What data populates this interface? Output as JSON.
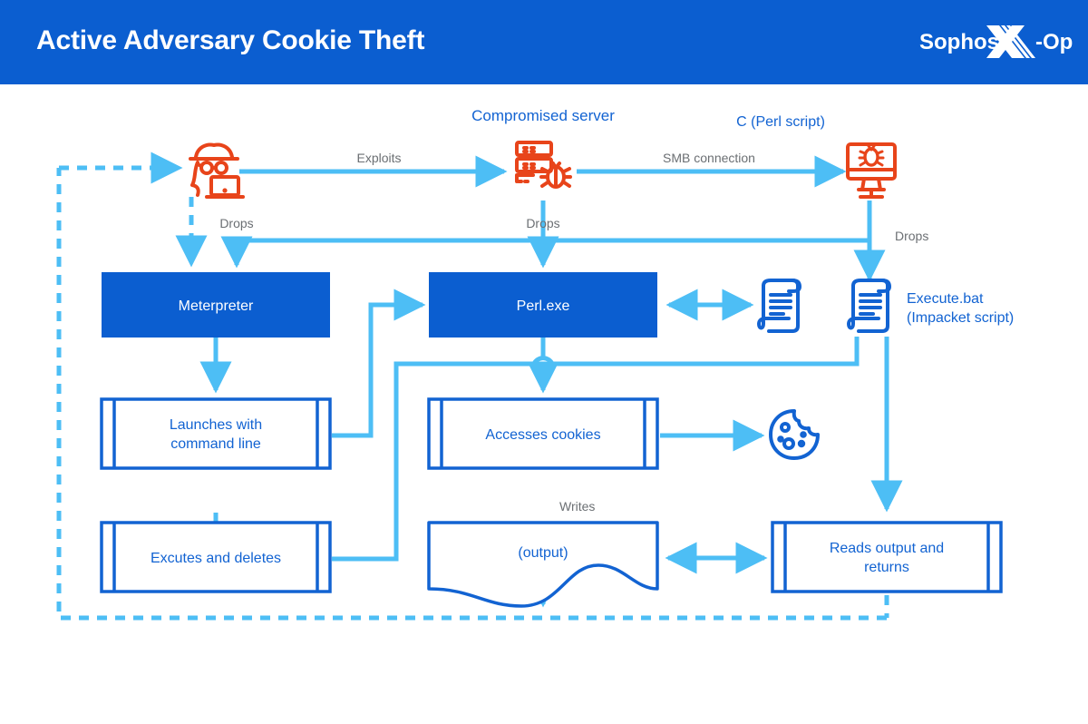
{
  "header": {
    "title": "Active Adversary Cookie Theft",
    "logo_text_left": "Sophos",
    "logo_text_right": "-Ops",
    "logo_mark": "x-mark-icon",
    "bg_color": "#0b5ed0"
  },
  "colors": {
    "brand_blue": "#0b5ed0",
    "dark_blue": "#1263d2",
    "light_blue": "#4dbef5",
    "orange": "#e8441a",
    "label_grey": "#6b6f73",
    "white": "#ffffff"
  },
  "nodes": {
    "attacker": {
      "icon": "hacker-laptop-icon",
      "label": ""
    },
    "compromised_server": {
      "icon": "server-bug-icon",
      "label": "Compromised server"
    },
    "victim_host": {
      "icon": "monitor-bug-icon",
      "label": ""
    },
    "meterpreter": {
      "label": "Meterpreter",
      "shape": "filled-box"
    },
    "perl_exe": {
      "label": "Perl.exe",
      "shape": "filled-box"
    },
    "perl_script": {
      "label": "C (Perl script)",
      "icon": "scroll-icon"
    },
    "execute_bat": {
      "label": "Execute.bat\n(Impacket script)",
      "label_line1": "Execute.bat",
      "label_line2": "(Impacket script)",
      "icon": "scroll-icon"
    },
    "launches": {
      "label_line1": "Launches with",
      "label_line2": "command line",
      "shape": "process"
    },
    "accesses_cookies": {
      "label": "Accesses cookies",
      "shape": "process"
    },
    "cookie": {
      "icon": "cookie-icon"
    },
    "executes_deletes": {
      "label": "Excutes and deletes",
      "shape": "process"
    },
    "output": {
      "label": "(output)",
      "shape": "document"
    },
    "reads_output": {
      "label_line1": "Reads output and",
      "label_line2": "returns",
      "shape": "process"
    }
  },
  "edges": {
    "exploits": "Exploits",
    "smb_connection": "SMB connection",
    "drops_attacker": "Drops",
    "drops_server": "Drops",
    "drops_host": "Drops",
    "writes": "Writes"
  }
}
